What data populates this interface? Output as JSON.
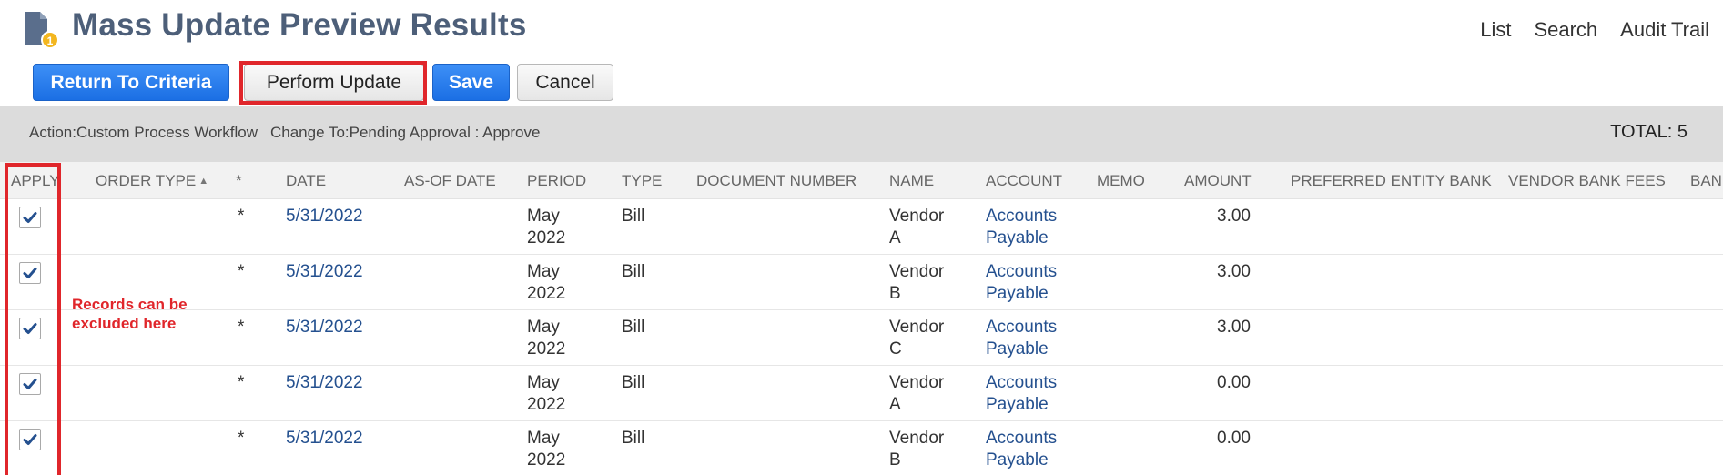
{
  "header": {
    "title": "Mass Update Preview Results",
    "icon": "mass-update-document-icon",
    "links": [
      "List",
      "Search",
      "Audit Trail"
    ]
  },
  "toolbar": {
    "return_label": "Return To Criteria",
    "perform_label": "Perform Update",
    "save_label": "Save",
    "cancel_label": "Cancel"
  },
  "summary": {
    "action": "Action:Custom Process Workflow",
    "change_to": "Change To:Pending Approval : Approve",
    "total": "TOTAL: 5"
  },
  "table": {
    "columns": [
      "APPLY",
      "ORDER TYPE",
      "*",
      "DATE",
      "AS-OF DATE",
      "PERIOD",
      "TYPE",
      "DOCUMENT NUMBER",
      "NAME",
      "ACCOUNT",
      "MEMO",
      "AMOUNT",
      "PREFERRED ENTITY BANK",
      "VENDOR BANK FEES",
      "BANK"
    ],
    "rows": [
      {
        "apply": true,
        "star": "*",
        "date": "5/31/2022",
        "period_month": "May",
        "period_year": "2022",
        "type": "Bill",
        "name_line1": "Vendor",
        "name_line2": "A",
        "account_line1": "Accounts",
        "account_line2": "Payable",
        "amount": "3.00"
      },
      {
        "apply": true,
        "star": "*",
        "date": "5/31/2022",
        "period_month": "May",
        "period_year": "2022",
        "type": "Bill",
        "name_line1": "Vendor",
        "name_line2": "B",
        "account_line1": "Accounts",
        "account_line2": "Payable",
        "amount": "3.00"
      },
      {
        "apply": true,
        "star": "*",
        "date": "5/31/2022",
        "period_month": "May",
        "period_year": "2022",
        "type": "Bill",
        "name_line1": "Vendor",
        "name_line2": "C",
        "account_line1": "Accounts",
        "account_line2": "Payable",
        "amount": "3.00"
      },
      {
        "apply": true,
        "star": "*",
        "date": "5/31/2022",
        "period_month": "May",
        "period_year": "2022",
        "type": "Bill",
        "name_line1": "Vendor",
        "name_line2": "A",
        "account_line1": "Accounts",
        "account_line2": "Payable",
        "amount": "0.00"
      },
      {
        "apply": true,
        "star": "*",
        "date": "5/31/2022",
        "period_month": "May",
        "period_year": "2022",
        "type": "Bill",
        "name_line1": "Vendor",
        "name_line2": "B",
        "account_line1": "Accounts",
        "account_line2": "Payable",
        "amount": "0.00"
      }
    ]
  },
  "annotations": {
    "note_line1": "Records can be",
    "note_line2": "excluded here",
    "color": "#e0262b"
  },
  "colors": {
    "title": "#4d5f79",
    "primary_button": "#2a7ff0",
    "link": "#24508f",
    "summary_bar": "#dcdcdc"
  }
}
